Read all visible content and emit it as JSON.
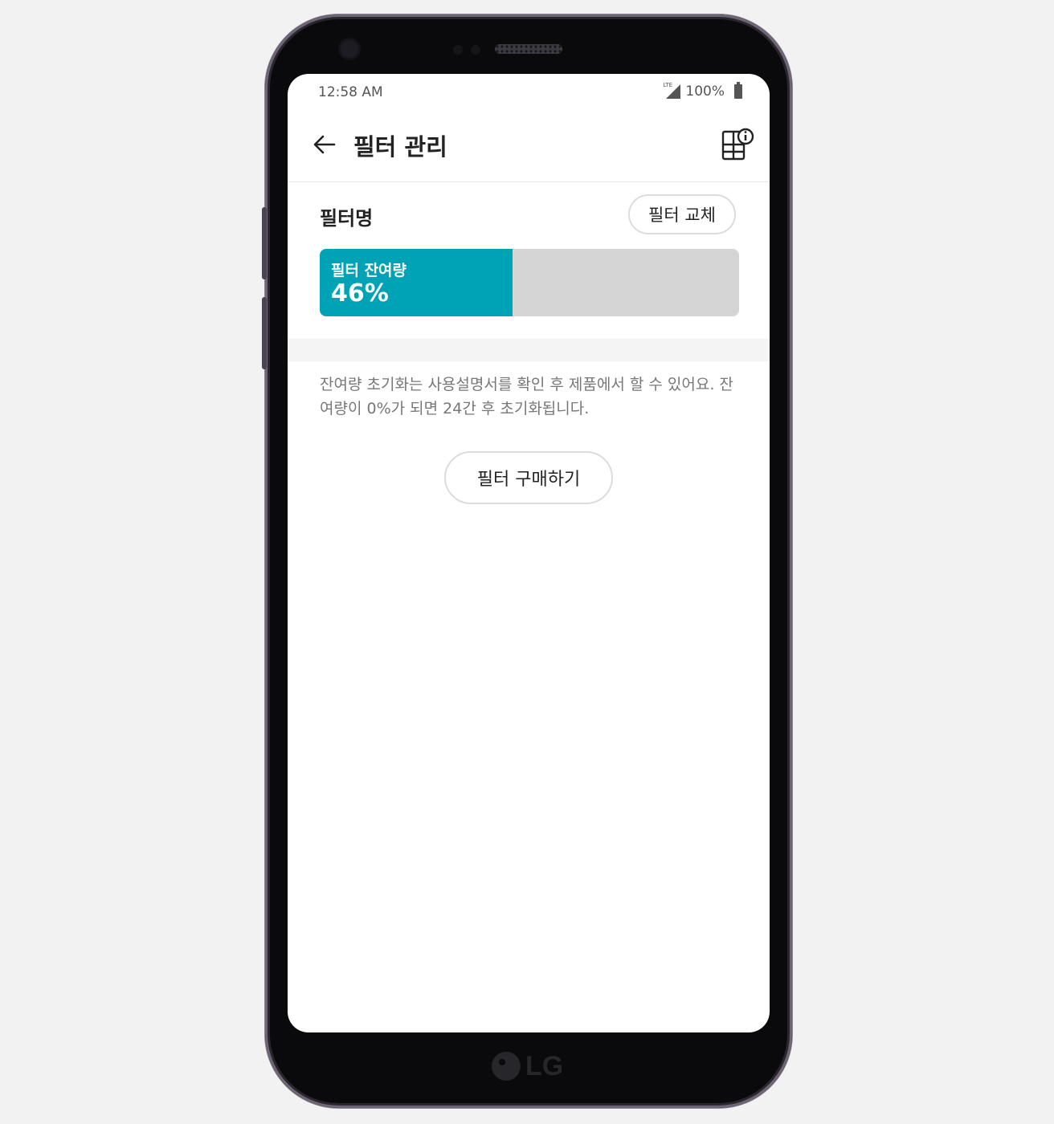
{
  "status_bar": {
    "time": "12:58 AM",
    "network": "LTE",
    "battery": "100%"
  },
  "app_bar": {
    "title": "필터 관리",
    "back_icon": "arrow-left-icon",
    "info_icon": "filter-info-icon"
  },
  "filter": {
    "name": "필터명",
    "replace_label": "필터 교체",
    "remaining_label": "필터 잔여량",
    "remaining_text": "46%",
    "remaining_fraction": 0.46,
    "bar_color": "#00a2b6",
    "bar_track_color": "#d5d5d5"
  },
  "notice": "잔여량 초기화는 사용설명서를 확인 후 제품에서 할 수 있어요. 잔여량이 0%가 되면 24간 후 초기화됩니다.",
  "buy_button_label": "필터 구매하기",
  "device": {
    "brand": "LG"
  }
}
